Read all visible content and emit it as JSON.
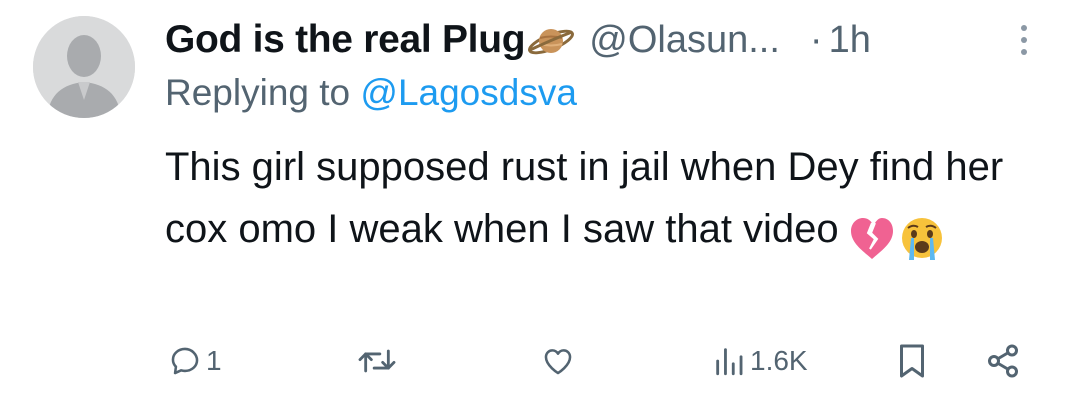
{
  "tweet": {
    "display_name": "God is the real Plug",
    "name_emoji": "saturn-icon",
    "handle": "@Olasun...",
    "separator": "·",
    "time": "1h",
    "replying_prefix": "Replying to",
    "replying_handle": "@Lagosdsva",
    "text": "This girl supposed rust in jail when Dey find her cox omo I weak when I saw that video",
    "text_emojis": [
      "broken-heart-icon",
      "crying-face-icon"
    ]
  },
  "actions": {
    "reply_count": "1",
    "retweet_count": "",
    "like_count": "",
    "views_count": "1.6K"
  },
  "colors": {
    "text": "#0f1419",
    "muted": "#536471",
    "link": "#1d9bf0",
    "avatar_bg": "#d9dadb"
  }
}
